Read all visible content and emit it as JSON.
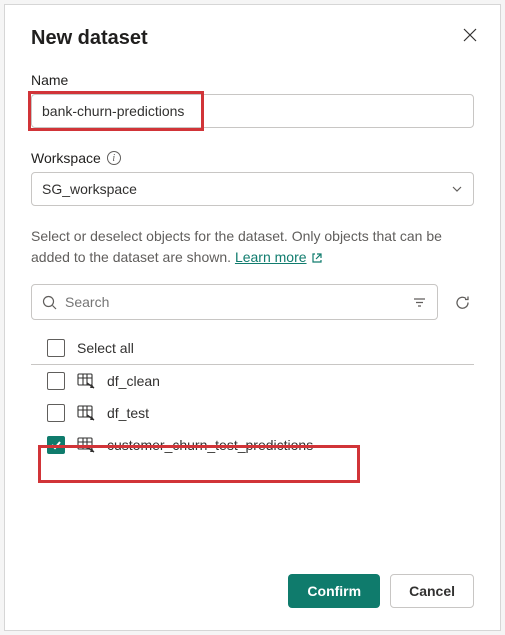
{
  "dialog": {
    "title": "New dataset",
    "name_label": "Name",
    "name_value": "bank-churn-predictions",
    "workspace_label": "Workspace",
    "workspace_value": "SG_workspace",
    "helper_text": "Select or deselect objects for the dataset. Only objects that can be added to the dataset are shown. ",
    "learn_more": "Learn more ",
    "search_placeholder": "Search",
    "select_all_label": "Select all",
    "items": [
      {
        "label": "df_clean",
        "checked": false
      },
      {
        "label": "df_test",
        "checked": false
      },
      {
        "label": "customer_churn_test_predictions",
        "checked": true
      }
    ],
    "confirm_label": "Confirm",
    "cancel_label": "Cancel"
  }
}
